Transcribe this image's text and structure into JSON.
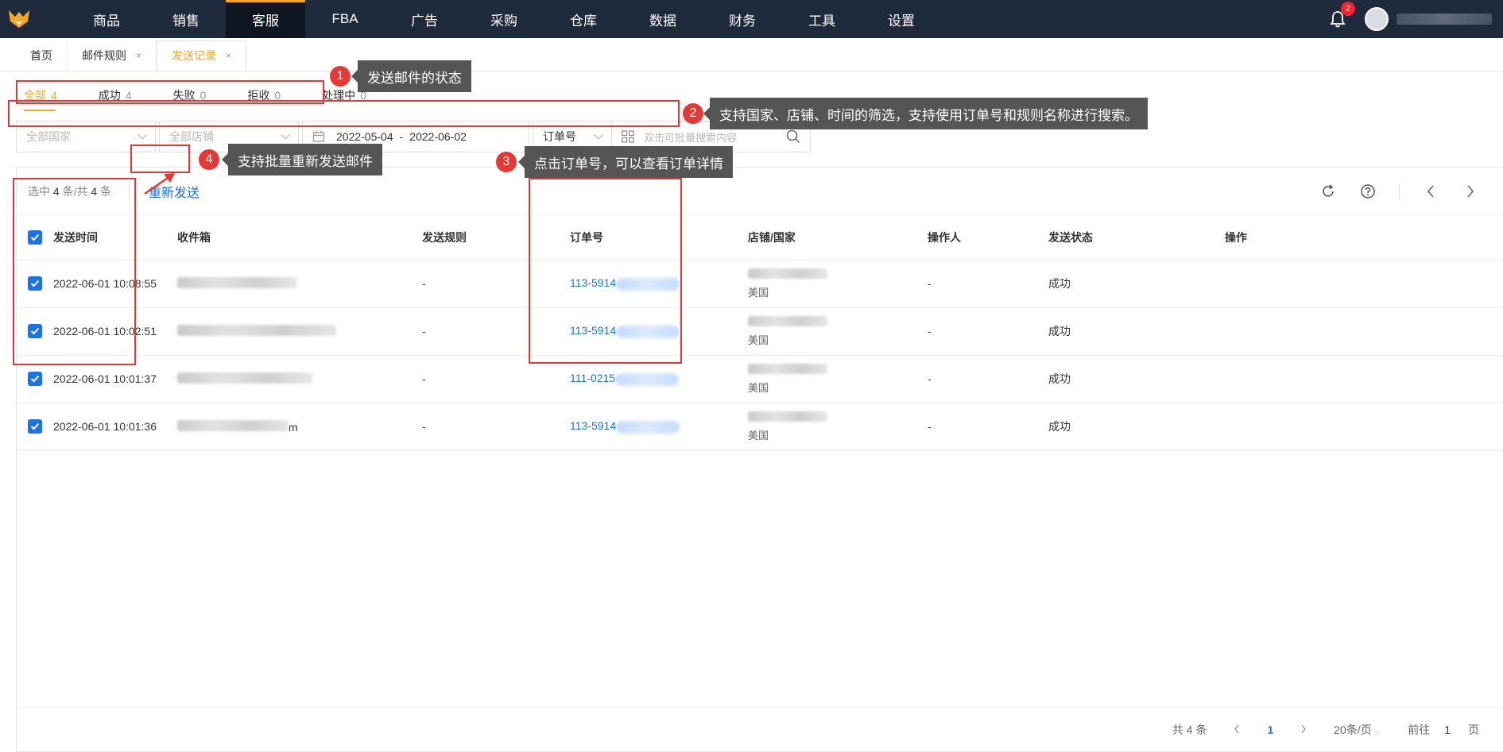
{
  "topnav": {
    "items": [
      "商品",
      "销售",
      "客服",
      "FBA",
      "广告",
      "采购",
      "仓库",
      "数据",
      "财务",
      "工具",
      "设置"
    ],
    "active_index": 2,
    "notification_count": "2",
    "colors": {
      "bg": "#1f2a3c",
      "accent": "#f5a623"
    }
  },
  "page_tabs": [
    {
      "label": "首页"
    },
    {
      "label": "邮件规则",
      "close": "×"
    },
    {
      "label": "发送记录",
      "close": "×"
    }
  ],
  "status_tabs": [
    {
      "label": "全部",
      "count": "4"
    },
    {
      "label": "成功",
      "count": "4"
    },
    {
      "label": "失败",
      "count": "0"
    },
    {
      "label": "拒收",
      "count": "0"
    },
    {
      "label": "处理中",
      "count": "0"
    }
  ],
  "filters": {
    "country_placeholder": "全部国家",
    "store_placeholder": "全部店铺",
    "date_start": "2022-05-04",
    "date_sep": "-",
    "date_end": "2022-06-02",
    "search_type": "订单号",
    "search_placeholder": "双击可批量搜索内容"
  },
  "toolbar": {
    "selected_prefix": "选中",
    "selected_count": "4",
    "selected_mid": "条/共",
    "total_count": "4",
    "selected_suffix": "条",
    "resend_label": "重新发送"
  },
  "table": {
    "headers": [
      "发送时间",
      "收件箱",
      "发送规则",
      "订单号",
      "店铺/国家",
      "操作人",
      "发送状态",
      "操作"
    ],
    "rows": [
      {
        "time": "2022-06-01 10:08:55",
        "email_suffix": "",
        "rule": "-",
        "order": "113-5914",
        "country": "美国",
        "operator": "-",
        "status": "成功"
      },
      {
        "time": "2022-06-01 10:02:51",
        "email_suffix": "",
        "rule": "-",
        "order": "113-5914",
        "country": "美国",
        "operator": "-",
        "status": "成功"
      },
      {
        "time": "2022-06-01 10:01:37",
        "email_suffix": "",
        "rule": "-",
        "order": "111-0215",
        "country": "美国",
        "operator": "-",
        "status": "成功"
      },
      {
        "time": "2022-06-01 10:01:36",
        "email_suffix": "m",
        "rule": "-",
        "order": "113-5914",
        "country": "美国",
        "operator": "-",
        "status": "成功"
      }
    ]
  },
  "pager": {
    "total": "共 4 条",
    "current": "1",
    "page_size": "20条/页",
    "goto_label": "前往",
    "goto_value": "1",
    "goto_suffix": "页"
  },
  "annotations": [
    {
      "num": "1",
      "text": "发送邮件的状态"
    },
    {
      "num": "2",
      "text": "支持国家、店铺、时间的筛选，支持使用订单号和规则名称进行搜索。"
    },
    {
      "num": "3",
      "text": "点击订单号，可以查看订单详情"
    },
    {
      "num": "4",
      "text": "支持批量重新发送邮件"
    }
  ]
}
